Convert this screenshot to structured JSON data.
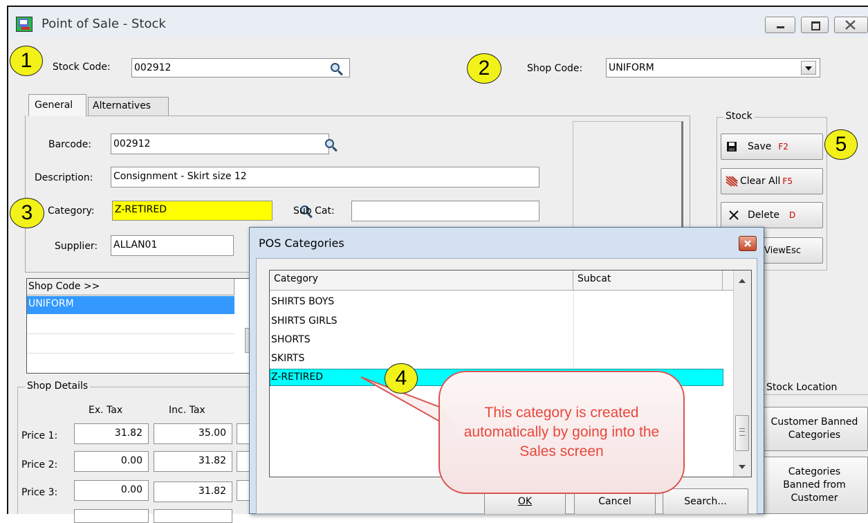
{
  "window": {
    "title": "Point of Sale - Stock"
  },
  "callouts": {
    "c1": "1",
    "c2": "2",
    "c3": "3",
    "c4": "4",
    "c5": "5"
  },
  "stock_code": {
    "label": "Stock Code:",
    "value": "002912"
  },
  "shop_code": {
    "label": "Shop Code:",
    "value": "UNIFORM"
  },
  "tabs": [
    {
      "label": "General"
    },
    {
      "label": "Alternatives"
    }
  ],
  "form": {
    "barcode_label": "Barcode:",
    "barcode_value": "002912",
    "description_label": "Description:",
    "description_value": "Consignment - Skirt size 12",
    "category_label": "Category:",
    "category_value": "Z-RETIRED",
    "subcat_label": "Sub Cat:",
    "subcat_value": "",
    "supplier_label": "Supplier:",
    "supplier_value": "ALLAN01"
  },
  "shop_grid": {
    "header": "Shop Code >>",
    "rows": [
      "UNIFORM"
    ]
  },
  "shop_details": {
    "group_label": "Shop Details",
    "col_extax": "Ex. Tax",
    "col_inctax": "Inc. Tax",
    "prices": [
      {
        "label": "Price 1:",
        "ex": "31.82",
        "inc": "35.00"
      },
      {
        "label": "Price 2:",
        "ex": "0.00",
        "inc": "31.82"
      },
      {
        "label": "Price 3:",
        "ex": "0.00",
        "inc": "31.82"
      }
    ]
  },
  "stock_group": {
    "label": "Stock",
    "save": {
      "label": "Save",
      "key": "F2"
    },
    "clear": {
      "label": "Clear All",
      "key": "F5"
    },
    "delete": {
      "label": "Delete",
      "key": "D"
    },
    "view": {
      "label": "ViewEsc"
    }
  },
  "stock_location": {
    "label": "Stock Location"
  },
  "side_buttons": {
    "banned1": "Customer Banned Categories",
    "banned2": "Categories Banned from Customer"
  },
  "dialog": {
    "title": "POS Categories",
    "col_category": "Category",
    "col_subcat": "Subcat",
    "rows": [
      "SHIRTS BOYS",
      "SHIRTS GIRLS",
      "SHORTS",
      "SKIRTS",
      "Z-RETIRED"
    ],
    "ok": "OK",
    "cancel": "Cancel",
    "search": "Search..."
  },
  "bubble_text": "This category is created automatically by going into the Sales screen",
  "colors": {
    "highlight": "#00ffff",
    "selected": "#3399ff",
    "accent": "#cc0000",
    "callout": "#f2f21a",
    "bubble_text": "#e8473b"
  }
}
